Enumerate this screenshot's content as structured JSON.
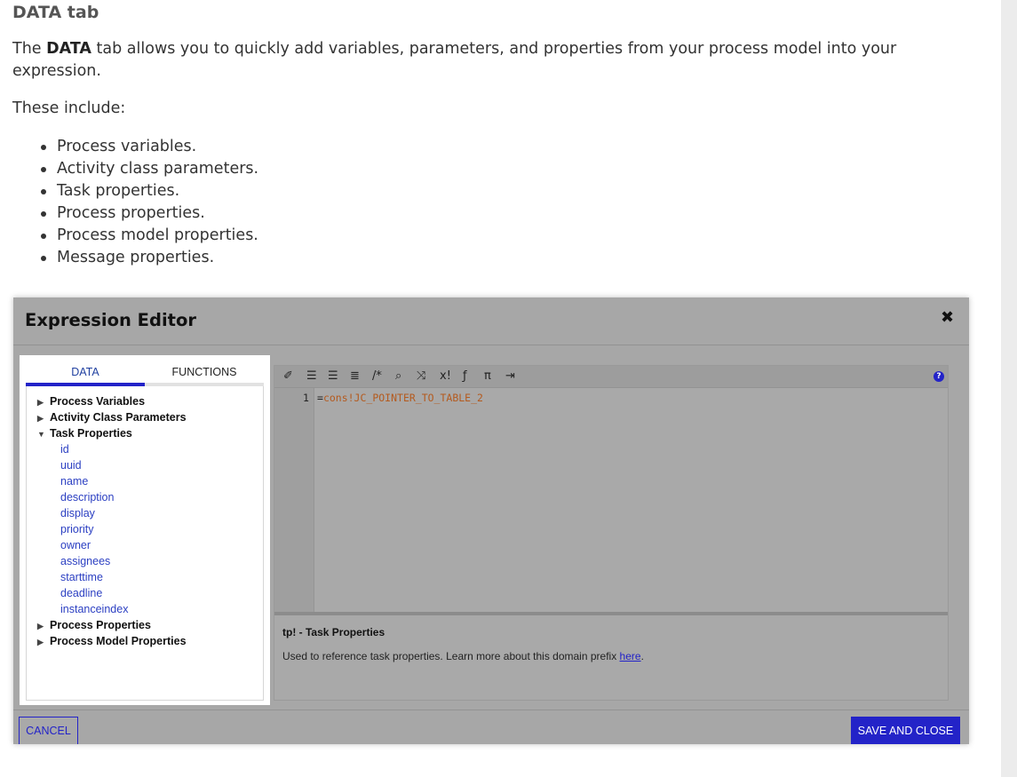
{
  "article": {
    "heading": "DATA tab",
    "intro_prefix": "The ",
    "intro_bold": "DATA",
    "intro_suffix": " tab allows you to quickly add variables, parameters, and properties from your process model into your expression.",
    "lead": "These include:",
    "bullets": [
      "Process variables.",
      "Activity class parameters.",
      "Task properties.",
      "Process properties.",
      "Process model properties.",
      "Message properties."
    ]
  },
  "dialog": {
    "title": "Expression Editor",
    "close_glyph": "✖",
    "tabs": {
      "data": "DATA",
      "functions": "FUNCTIONS"
    },
    "tree": {
      "categories": {
        "process_variables": "Process Variables",
        "activity_class_parameters": "Activity Class Parameters",
        "task_properties": "Task Properties",
        "process_properties": "Process Properties",
        "process_model_properties": "Process Model Properties"
      },
      "task_property_items": [
        "id",
        "uuid",
        "name",
        "description",
        "display",
        "priority",
        "owner",
        "assignees",
        "starttime",
        "deadline",
        "instanceindex"
      ]
    },
    "editor": {
      "line_number": "1",
      "code_prefix": "=",
      "code": "cons!JC_POINTER_TO_TABLE_2",
      "toolbar_icons": [
        "magic-wand-icon",
        "outdent-icon",
        "indent-icon",
        "list-icon",
        "comment-icon",
        "search-icon",
        "shuffle-icon",
        "test-icon",
        "function-icon",
        "pi-icon",
        "export-icon",
        "help-icon"
      ]
    },
    "info": {
      "title": "tp! - Task Properties",
      "text_prefix": "Used to reference task properties. Learn more about this domain prefix ",
      "link": "here",
      "text_suffix": "."
    },
    "buttons": {
      "cancel": "CANCEL",
      "save": "SAVE AND CLOSE"
    },
    "colors": {
      "accent": "#2323c8",
      "overlay": "#a7a7a7",
      "code": "#b45a1e"
    }
  }
}
